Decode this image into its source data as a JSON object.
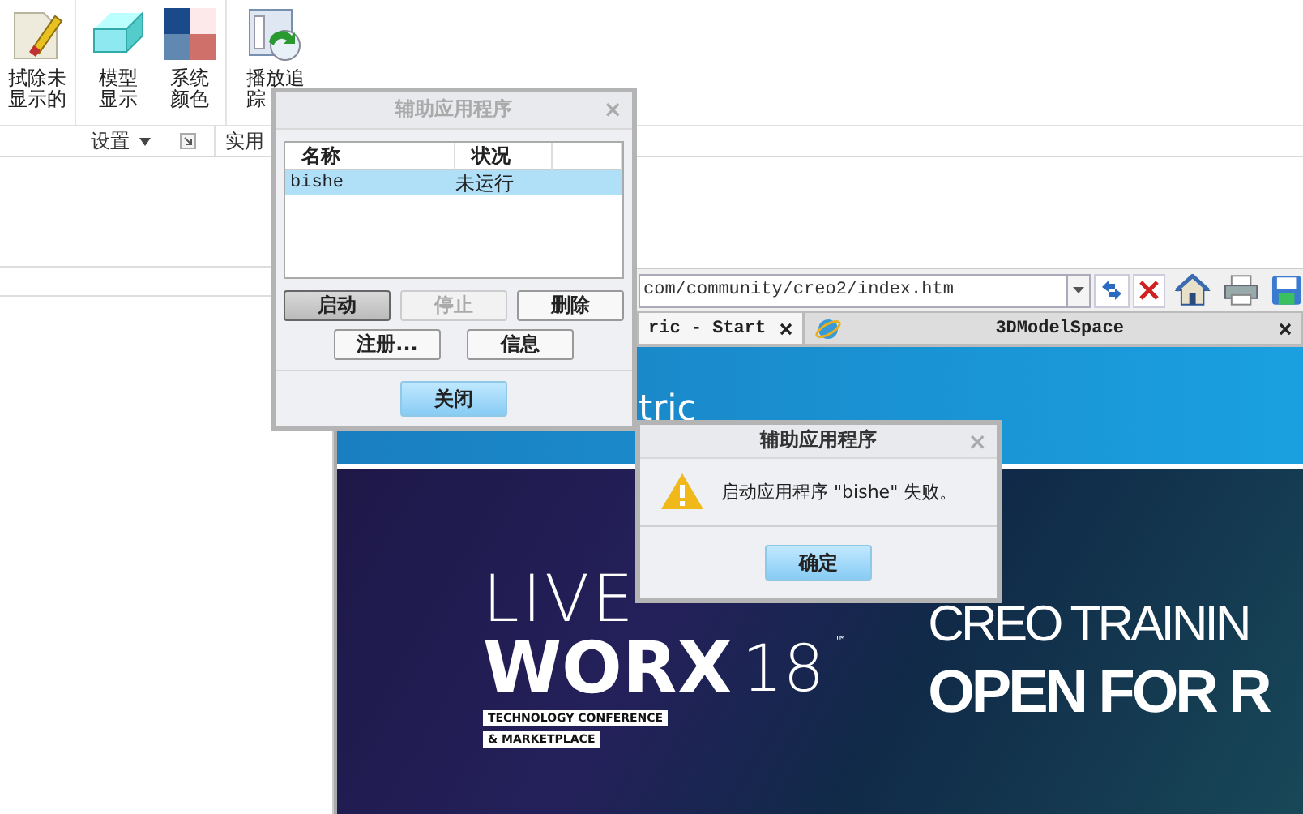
{
  "ribbon": {
    "buttons": [
      {
        "kind": "erase",
        "label_lines": [
          "拭除未",
          "显示的"
        ]
      },
      {
        "kind": "model",
        "label_lines": [
          "模型",
          "显示"
        ]
      },
      {
        "kind": "color",
        "label_lines": [
          "系统",
          "颜色"
        ]
      },
      {
        "kind": "playback",
        "label_lines": [
          "播放追",
          "踪"
        ]
      }
    ],
    "groups": [
      {
        "label": "设置",
        "menu": true,
        "launcher": true
      },
      {
        "label": "实用",
        "menu": false,
        "launcher": false
      }
    ]
  },
  "browser": {
    "address": "com/community/creo2/index.htm",
    "tabs": [
      {
        "label": "ric - Start",
        "selected": true,
        "icon": false
      },
      {
        "label": "3DModelSpace",
        "selected": false,
        "icon": true
      }
    ],
    "page": {
      "banner_text": "tric",
      "image_texts": {
        "live": "LIVE",
        "worx": "WORX",
        "number": "18",
        "trademark": "™",
        "tag_lines": [
          "TECHNOLOGY CONFERENCE",
          "& MARKETPLACE"
        ],
        "headline": "CREO TRAININ",
        "subheadline": "OPEN FOR R"
      }
    }
  },
  "dialogs": [
    {
      "title": "辅助应用程序",
      "active": false,
      "close": "×",
      "list": {
        "columns": [
          "名称",
          "状况"
        ],
        "rows": [
          {
            "cells": [
              "bishe",
              "未运行"
            ],
            "selected": true
          }
        ]
      },
      "button_rows": [
        [
          {
            "label": "启动",
            "kind": "pressed",
            "disabled": false
          },
          {
            "label": "停止",
            "kind": "normal",
            "disabled": true
          },
          {
            "label": "删除",
            "kind": "normal",
            "disabled": false
          }
        ],
        [
          {
            "label": "注册...",
            "kind": "normal",
            "disabled": false
          },
          {
            "label": "信息",
            "kind": "normal",
            "disabled": false
          }
        ]
      ],
      "footer_buttons": [
        {
          "label": "关闭",
          "kind": "primary",
          "disabled": false
        }
      ]
    },
    {
      "title": "辅助应用程序",
      "active": true,
      "close": "×",
      "message": {
        "kind": "warning",
        "text": "启动应用程序 \"bishe\" 失败。"
      },
      "footer_buttons": [
        {
          "label": "确定",
          "kind": "primary",
          "disabled": false
        }
      ]
    }
  ]
}
